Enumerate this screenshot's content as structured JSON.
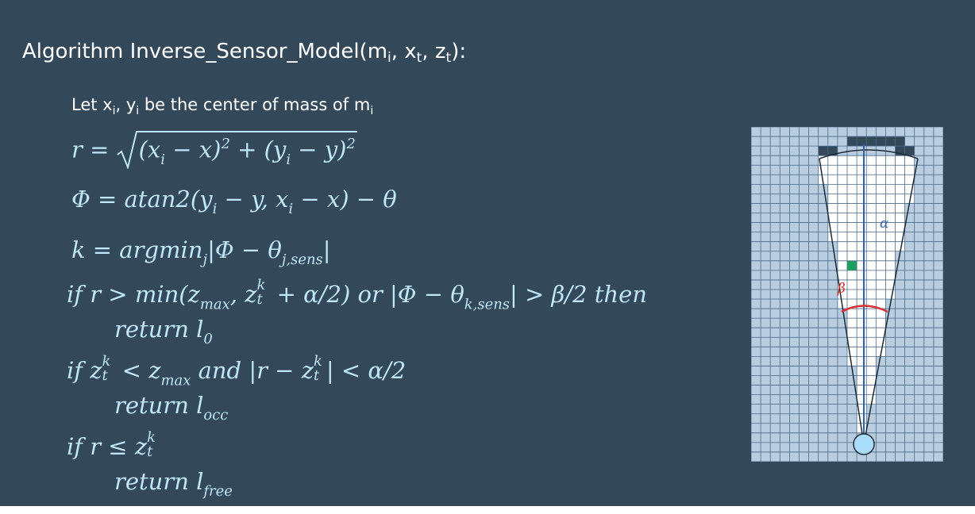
{
  "title": {
    "prefix": "Algorithm Inverse_Sensor_Model(m",
    "sub_m": "i",
    "sep1": ", x",
    "sub_x": "t",
    "sep2": ", z",
    "sub_z": "t",
    "suffix": "):"
  },
  "intro": {
    "part1": "Let x",
    "sub1": "i",
    "part2": ", y",
    "sub2": "i",
    "part3": " be the center of mass of m",
    "sub3": "i"
  },
  "equations": {
    "r_line": {
      "lhs": "r =",
      "radicand": "(x",
      "i1": "i",
      "mid1": " − x)",
      "pow1": "2",
      "plus": " + (y",
      "i2": "i",
      "mid2": " − y)",
      "pow2": "2"
    },
    "phi_line": {
      "text_a": "Φ = atan2(y",
      "sub_a": "i",
      "text_b": " − y, x",
      "sub_b": "i",
      "text_c": " − x) − θ"
    },
    "k_line": {
      "text_a": "k = argmin",
      "sub_a": "j",
      "text_b": "|Φ − θ",
      "sub_b": "j,sens",
      "text_c": "|"
    },
    "if1": {
      "text_a": "if r > min(z",
      "sub_a": "max",
      "text_b": ", z",
      "sup_b": "k",
      "sub_b": "t",
      "text_c": " + α/2) or |Φ − θ",
      "sub_c": "k,sens",
      "text_d": "| > β/2  then"
    },
    "ret1": {
      "text": "return l",
      "sub": "0"
    },
    "if2": {
      "text_a": "if z",
      "sup_a": "k",
      "sub_a": "t",
      "text_b": " < z",
      "sub_b": "max",
      "text_c": " and |r − z",
      "sup_c": "k",
      "sub_c": "t",
      "text_d": "| < α/2"
    },
    "ret2": {
      "text": "return  l",
      "sub": "occ"
    },
    "if3": {
      "text_a": "if r ≤ z",
      "sup_a": "k",
      "sub_a": "t"
    },
    "ret3": {
      "text": "return  l",
      "sub": "free"
    }
  },
  "figure": {
    "alpha_label": "α",
    "beta_label": "β",
    "colors": {
      "background": "#33495a",
      "grid_fill": "#b9cde0",
      "grid_line": "#4d6a85",
      "free_cell": "#ffffff",
      "occupied_cell": "#33495a",
      "target_cell": "#1aa160",
      "beam_line": "#2f5fa8",
      "beta_arc": "#d93232",
      "robot": "#a9dcf7"
    }
  }
}
